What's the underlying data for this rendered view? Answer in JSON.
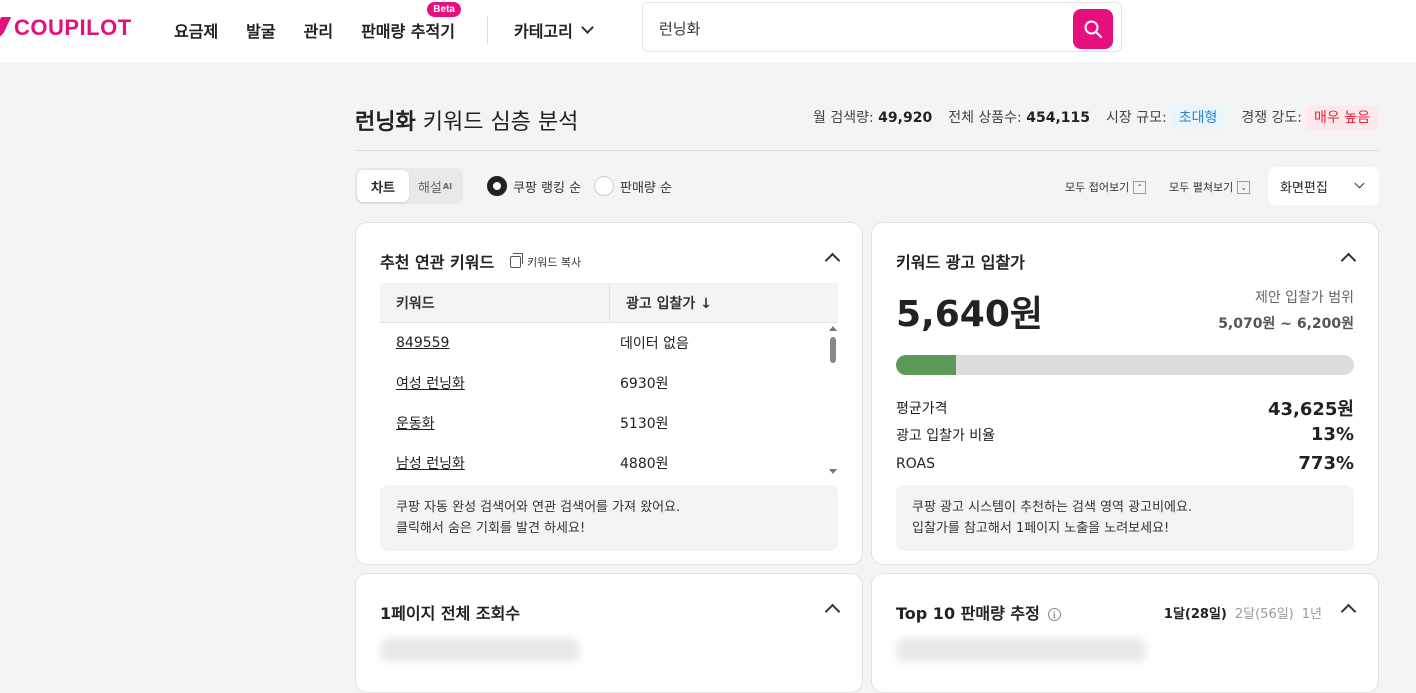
{
  "brand": {
    "name": "COUPILOT",
    "accent": "#e5107d"
  },
  "nav": {
    "items": [
      {
        "label": "요금제"
      },
      {
        "label": "발굴"
      },
      {
        "label": "관리"
      },
      {
        "label": "판매량 추적기",
        "badge": "Beta"
      }
    ],
    "category_label": "카테고리"
  },
  "search": {
    "value": "런닝화",
    "icon": "search-icon"
  },
  "page": {
    "keyword": "런닝화",
    "title_suffix": " 키워드 심층 분석",
    "stats": {
      "monthly_search_label": "월 검색량:",
      "monthly_search_value": "49,920",
      "total_products_label": "전체 상품수:",
      "total_products_value": "454,115",
      "market_size_label": "시장 규모:",
      "market_size_value": "초대형",
      "competition_label": "경쟁 강도:",
      "competition_value": "매우 높음"
    }
  },
  "controls": {
    "seg_chart": "차트",
    "seg_explain": "해설",
    "seg_explain_sup": "AI",
    "radio_rank": "쿠팡 랭킹 순",
    "radio_sales": "판매량 순",
    "collapse_all": "모두 접어보기",
    "expand_all": "모두 펼쳐보기",
    "edit_screen": "화면편집"
  },
  "related_keywords": {
    "title": "추천 연관 키워드",
    "copy_label": "키워드 복사",
    "col_keyword": "키워드",
    "col_bid": "광고 입찰가 ↓",
    "rows": [
      {
        "keyword": "849559",
        "bid": "데이터 없음"
      },
      {
        "keyword": "여성 런닝화",
        "bid": "6930원"
      },
      {
        "keyword": "운동화",
        "bid": "5130원"
      },
      {
        "keyword": "남성 런닝화",
        "bid": "4880원"
      }
    ],
    "note_line1": "쿠팡 자동 완성 검색어와 연관 검색어를 가져 왔어요.",
    "note_line2": "클릭해서 숨은 기회를 발견 하세요!"
  },
  "ad_bid": {
    "title": "키워드 광고 입찰가",
    "price": "5,640원",
    "range_label": "제안 입찰가 범위",
    "range_value": "5,070원 ~ 6,200원",
    "progress_fraction": 0.13,
    "progress_color": "#5e9a57",
    "avg_price_label": "평균가격",
    "avg_price_value": "43,625원",
    "bid_ratio_label": "광고 입찰가 비율",
    "bid_ratio_value": "13%",
    "roas_label": "ROAS",
    "roas_value": "773%",
    "note_line1": "쿠팡 광고 시스템이 추천하는 검색 영역 광고비에요.",
    "note_line2": "입찰가를 참고해서 1페이지 노출을 노려보세요!"
  },
  "page_views": {
    "title": "1페이지 전체 조회수"
  },
  "top10": {
    "title": "Top 10 판매량 추정",
    "periods": [
      "1달(28일)",
      "2달(56일)",
      "1년"
    ],
    "active_period": 0
  }
}
